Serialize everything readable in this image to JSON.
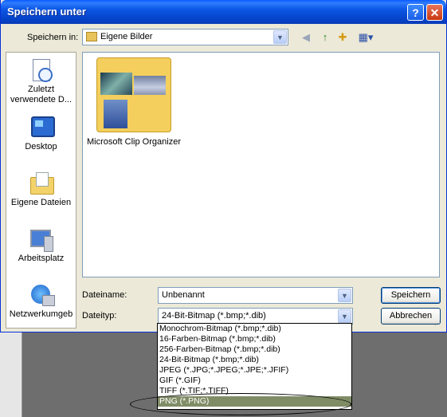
{
  "window": {
    "title": "Speichern unter",
    "help_glyph": "?",
    "close_glyph": "✕"
  },
  "toolbar": {
    "save_in_label": "Speichern in:",
    "location_value": "Eigene Bilder",
    "back_glyph": "◀",
    "up_glyph": "↑",
    "newfolder_glyph": "✚",
    "views_glyph": "▦▾"
  },
  "places": [
    {
      "label": "Zuletzt verwendete D..."
    },
    {
      "label": "Desktop"
    },
    {
      "label": "Eigene Dateien"
    },
    {
      "label": "Arbeitsplatz"
    },
    {
      "label": "Netzwerkumgeb"
    }
  ],
  "files": [
    {
      "name": "Microsoft Clip Organizer"
    }
  ],
  "form": {
    "filename_label": "Dateiname:",
    "filename_value": "Unbenannt",
    "filetype_label": "Dateityp:",
    "filetype_value": "24-Bit-Bitmap (*.bmp;*.dib)",
    "save_label": "Speichern",
    "cancel_label": "Abbrechen"
  },
  "filetype_options": [
    "Monochrom-Bitmap (*.bmp;*.dib)",
    "16-Farben-Bitmap (*.bmp;*.dib)",
    "256-Farben-Bitmap (*.bmp;*.dib)",
    "24-Bit-Bitmap (*.bmp;*.dib)",
    "JPEG (*.JPG;*.JPEG;*.JPE;*.JFIF)",
    "GIF (*.GIF)",
    "TIFF (*.TIF;*.TIFF)",
    "PNG (*.PNG)"
  ],
  "selected_option": "PNG (*.PNG)",
  "colors": {
    "title_bar": "#0b56e3",
    "dialog_bg": "#ece9d8",
    "selection": "#808c66"
  }
}
